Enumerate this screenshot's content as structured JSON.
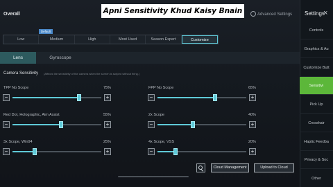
{
  "caption": "Apni Sensitivity Khud Kaisy Bnain",
  "header": {
    "title": "Overall",
    "advanced_label": "Advanced Settings"
  },
  "presets": {
    "default_badge": "Default",
    "items": [
      "Low",
      "Medium",
      "High",
      "Most Used",
      "Season Expert",
      "Customize"
    ],
    "selected": "Customize"
  },
  "tabs": {
    "items": [
      "Lens",
      "Gyroscope"
    ],
    "selected": "Lens"
  },
  "section": {
    "title": "Camera Sensitivity",
    "description": "(Affects the sensitivity of the camera when the screen is swiped without firing.)"
  },
  "sliders": [
    {
      "label": "TPP No Scope",
      "value": "75%",
      "level": 0.75
    },
    {
      "label": "FPP No Scope",
      "value": "65%",
      "level": 0.65
    },
    {
      "label": "Red Dot, Holographic, Aim Assist",
      "value": "55%",
      "level": 0.55
    },
    {
      "label": "2x Scope",
      "value": "40%",
      "level": 0.4
    },
    {
      "label": "3x Scope, Win94",
      "value": "25%",
      "level": 0.25
    },
    {
      "label": "4x Scope, VSS",
      "value": "20%",
      "level": 0.2
    }
  ],
  "buttons": {
    "minus": "−",
    "plus": "+",
    "cloud_management": "Cloud Management",
    "upload_to_cloud": "Upload to Cloud"
  },
  "sidebar": {
    "title": "Settings",
    "close": "×",
    "items": [
      "Controls",
      "Graphics & Au",
      "Customize Butt",
      "Sensitivi",
      "Pick Up",
      "Crosshair",
      "Haptic Feedba",
      "Privacy & Soc",
      "Other"
    ],
    "selected": "Sensitivi"
  },
  "colors": {
    "accent": "#5fcad8",
    "sidebar_active": "#5cb73a",
    "tab_active": "#2d5a5e",
    "badge": "#4a88c8"
  },
  "icons": {
    "search": "search-icon",
    "advanced": "gear-icon"
  }
}
